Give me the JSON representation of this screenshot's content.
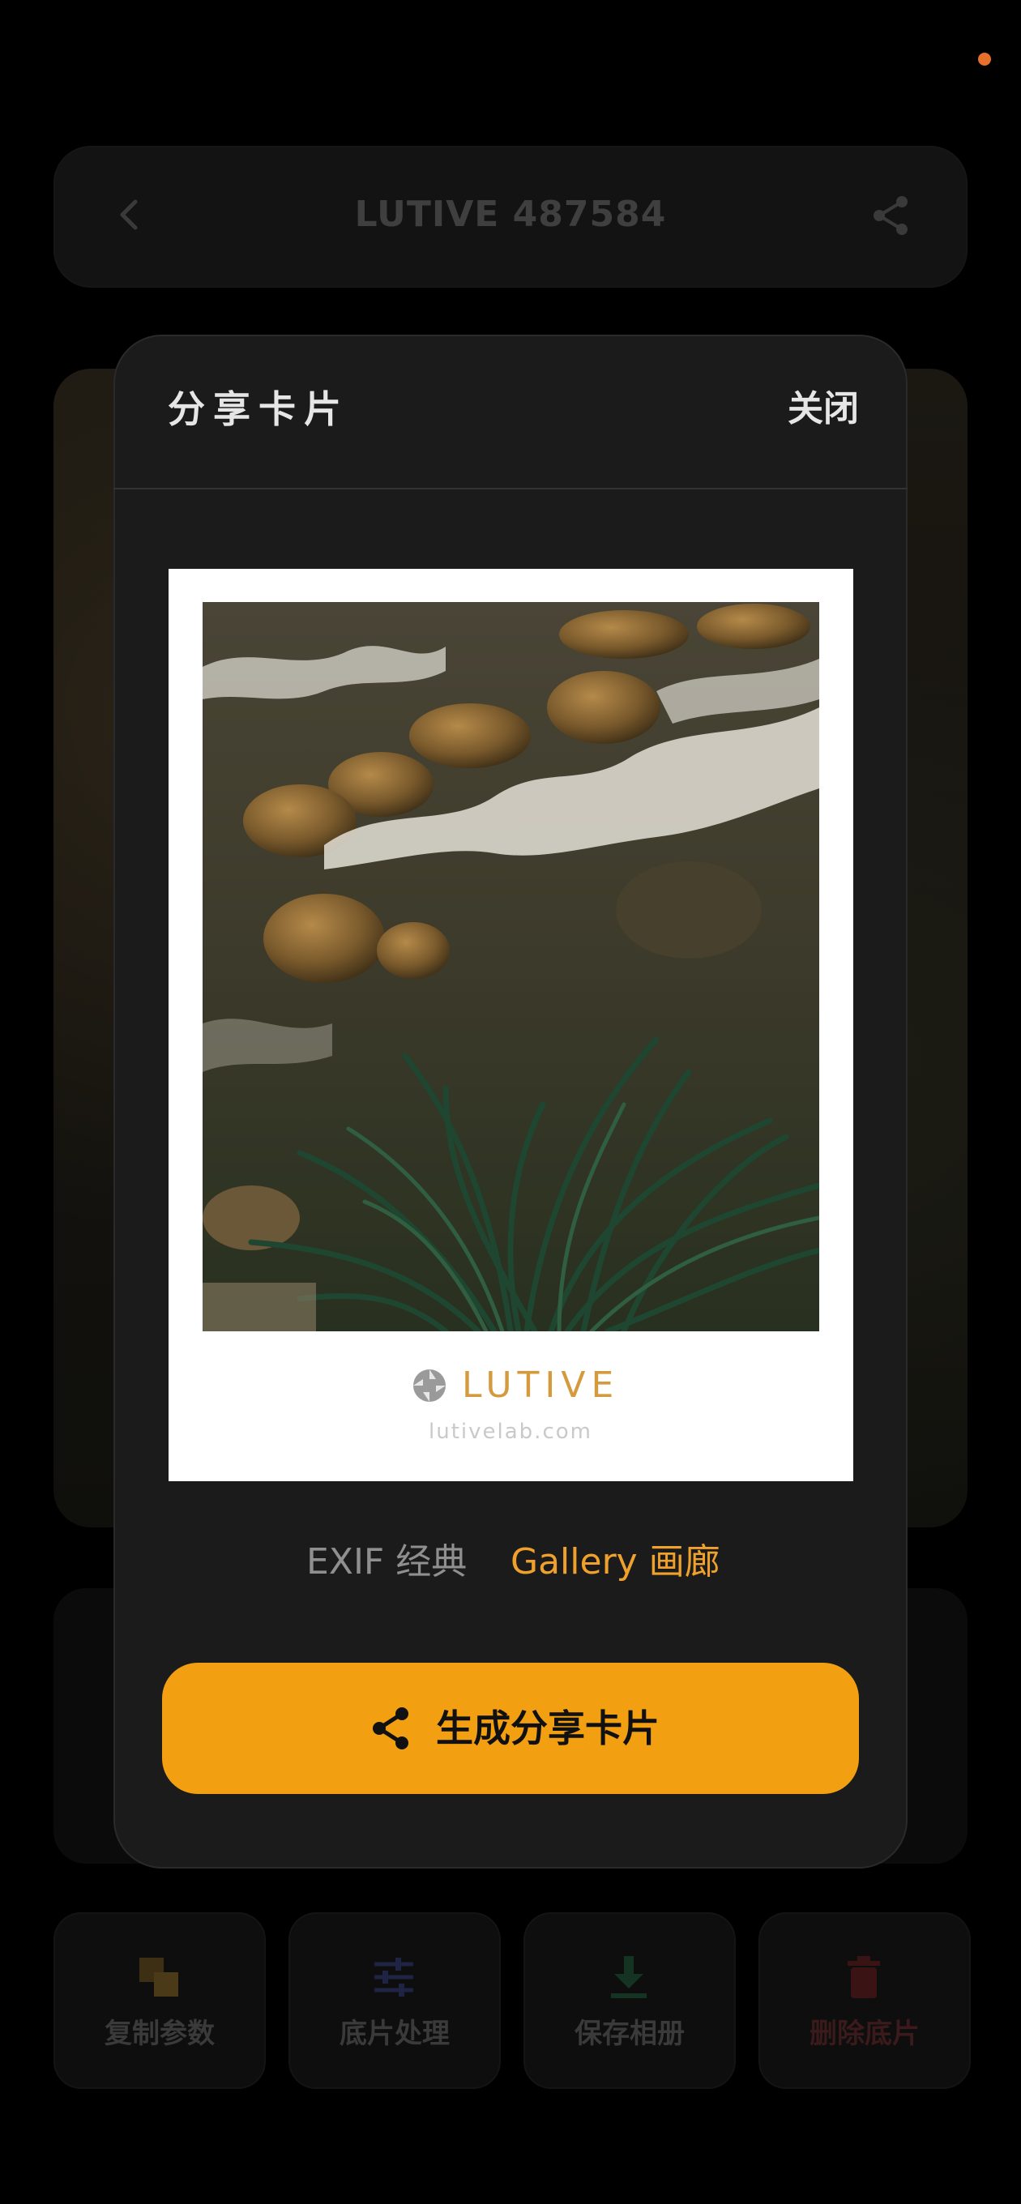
{
  "background": {
    "header": {
      "title": "LUTIVE 487584"
    },
    "actions": [
      {
        "label": "复制参数",
        "icon": "copy-params-icon",
        "color": "#3d2f14"
      },
      {
        "label": "底片处理",
        "icon": "sliders-icon",
        "color": "#1f2344"
      },
      {
        "label": "保存相册",
        "icon": "download-icon",
        "color": "#143322"
      },
      {
        "label": "删除底片",
        "icon": "trash-icon",
        "color": "#3a1414"
      }
    ]
  },
  "modal": {
    "title": "分享卡片",
    "close_label": "关闭",
    "card": {
      "brand_name": "LUTIVE",
      "brand_url": "lutivelab.com"
    },
    "tabs": [
      {
        "label": "EXIF 经典",
        "active": false
      },
      {
        "label": "Gallery 画廊",
        "active": true
      }
    ],
    "primary_button": "生成分享卡片",
    "accent_color": "#f29f12"
  }
}
